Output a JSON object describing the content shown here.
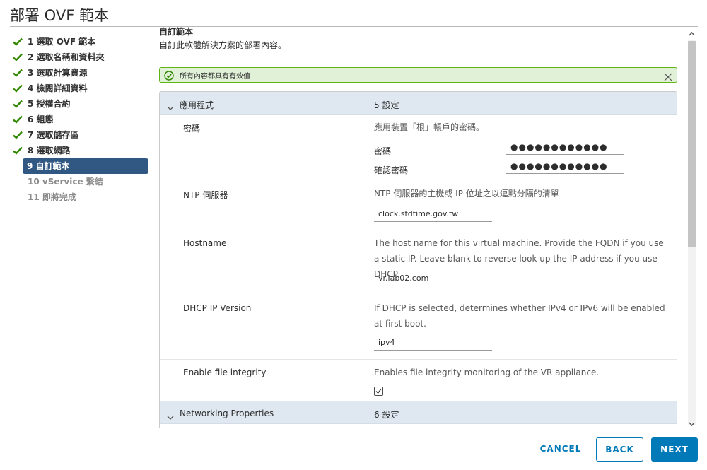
{
  "window": {
    "title": "部署 OVF 範本"
  },
  "steps": [
    {
      "label": "1 選取 OVF 範本",
      "state": "done"
    },
    {
      "label": "2 選取名稱和資料夾",
      "state": "done"
    },
    {
      "label": "3 選取計算資源",
      "state": "done"
    },
    {
      "label": "4 檢閱詳細資料",
      "state": "done"
    },
    {
      "label": "5 授權合約",
      "state": "done"
    },
    {
      "label": "6 組態",
      "state": "done"
    },
    {
      "label": "7 選取儲存區",
      "state": "done"
    },
    {
      "label": "8 選取網路",
      "state": "done"
    },
    {
      "label": "9 自訂範本",
      "state": "active"
    },
    {
      "label": "10 vService 繫結",
      "state": "future"
    },
    {
      "label": "11 即將完成",
      "state": "future"
    }
  ],
  "main": {
    "title": "自訂範本",
    "description": "自訂此軟體解決方案的部署內容。",
    "alert": {
      "message": "所有內容都具有有效值",
      "type": "success"
    },
    "groups": [
      {
        "name": "應用程式",
        "count": "5 設定",
        "expanded": true
      },
      {
        "name": "Networking Properties",
        "count": "6 設定",
        "expanded": false
      }
    ],
    "properties": {
      "password": {
        "label": "密碼",
        "description": "應用裝置「根」帳戶的密碼。",
        "field1_label": "密碼",
        "field1_value": "●●●●●●●●●●●●",
        "field2_label": "確認密碼",
        "field2_value": "●●●●●●●●●●●●"
      },
      "ntp": {
        "label": "NTP 伺服器",
        "description": "NTP 伺服器的主機或 IP 位址之以逗點分隔的清單",
        "value": "clock.stdtime.gov.tw"
      },
      "hostname": {
        "label": "Hostname",
        "description": "The host name for this virtual machine. Provide the FQDN if you use a static IP. Leave blank to reverse look up the IP address if you use DHCP.",
        "value": "vr.lab02.com"
      },
      "dhcp": {
        "label": "DHCP IP Version",
        "description": "If DHCP is selected, determines whether IPv4 or IPv6 will be enabled at first boot.",
        "value": "ipv4"
      },
      "integrity": {
        "label": "Enable file integrity",
        "description": "Enables file integrity monitoring of the VR appliance.",
        "checked": true
      }
    }
  },
  "footer": {
    "cancel": "CANCEL",
    "back": "BACK",
    "next": "NEXT"
  },
  "colors": {
    "accent": "#0079b8",
    "active_step": "#315883",
    "success": "#60b515",
    "check": "#318700",
    "group_header": "#dfe8f0"
  },
  "icons": {
    "step_done": "checkmark-icon",
    "alert": "success-circle-icon",
    "close": "close-icon",
    "group": "chevron-down-icon"
  }
}
